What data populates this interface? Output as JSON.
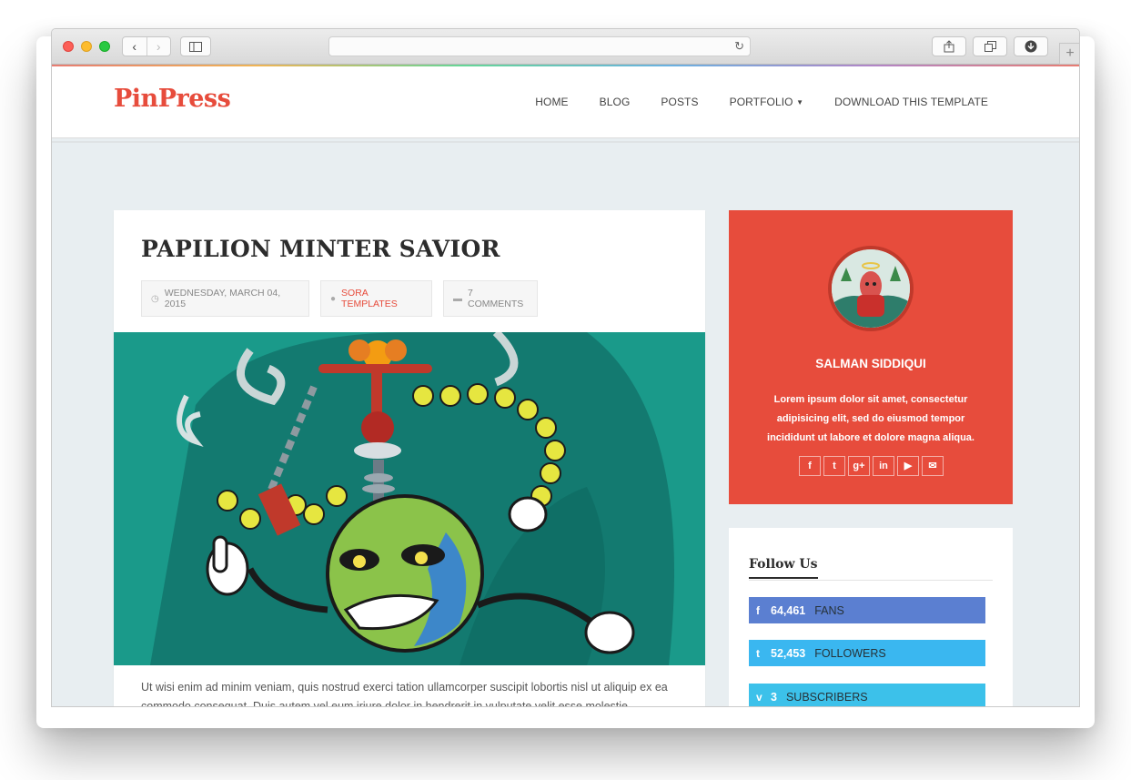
{
  "browser": {
    "nav_back": "‹",
    "nav_forward": "›",
    "reload_icon": "↻",
    "plus": "+"
  },
  "site": {
    "logo": "PinPress",
    "menu": {
      "home": "HOME",
      "blog": "BLOG",
      "posts": "POSTS",
      "portfolio": "PORTFOLIO",
      "download": "DOWNLOAD THIS TEMPLATE"
    }
  },
  "post": {
    "title": "PAPILION MINTER SAVIOR",
    "date": "WEDNESDAY, MARCH 04, 2015",
    "author": "SORA TEMPLATES",
    "comments": "7 COMMENTS",
    "excerpt": "Ut wisi enim ad minim veniam, quis nostrud exerci tation ullamcorper suscipit lobortis nisl ut aliquip ex ea commodo consequat. Duis autem vel eum iriure dolor in hendrerit in vulputate velit esse molestie"
  },
  "author_widget": {
    "name": "SALMAN SIDDIQUI",
    "bio": "Lorem ipsum dolor sit amet, consectetur adipisicing elit, sed do eiusmod tempor incididunt ut labore et dolore magna aliqua.",
    "socials": [
      "f",
      "t",
      "g+",
      "in",
      "yt",
      "mail"
    ]
  },
  "follow": {
    "title": "Follow Us",
    "facebook": {
      "count": "64,461",
      "label": "FANS"
    },
    "twitter": {
      "count": "52,453",
      "label": "FOLLOWERS"
    },
    "vimeo": {
      "count": "3",
      "label": "SUBSCRIBERS"
    }
  },
  "colors": {
    "accent": "#e74c3c",
    "facebook": "#5b7fd1",
    "twitter": "#3ab7f0",
    "vimeo": "#3cc1ea",
    "page_bg": "#e8eef1"
  }
}
